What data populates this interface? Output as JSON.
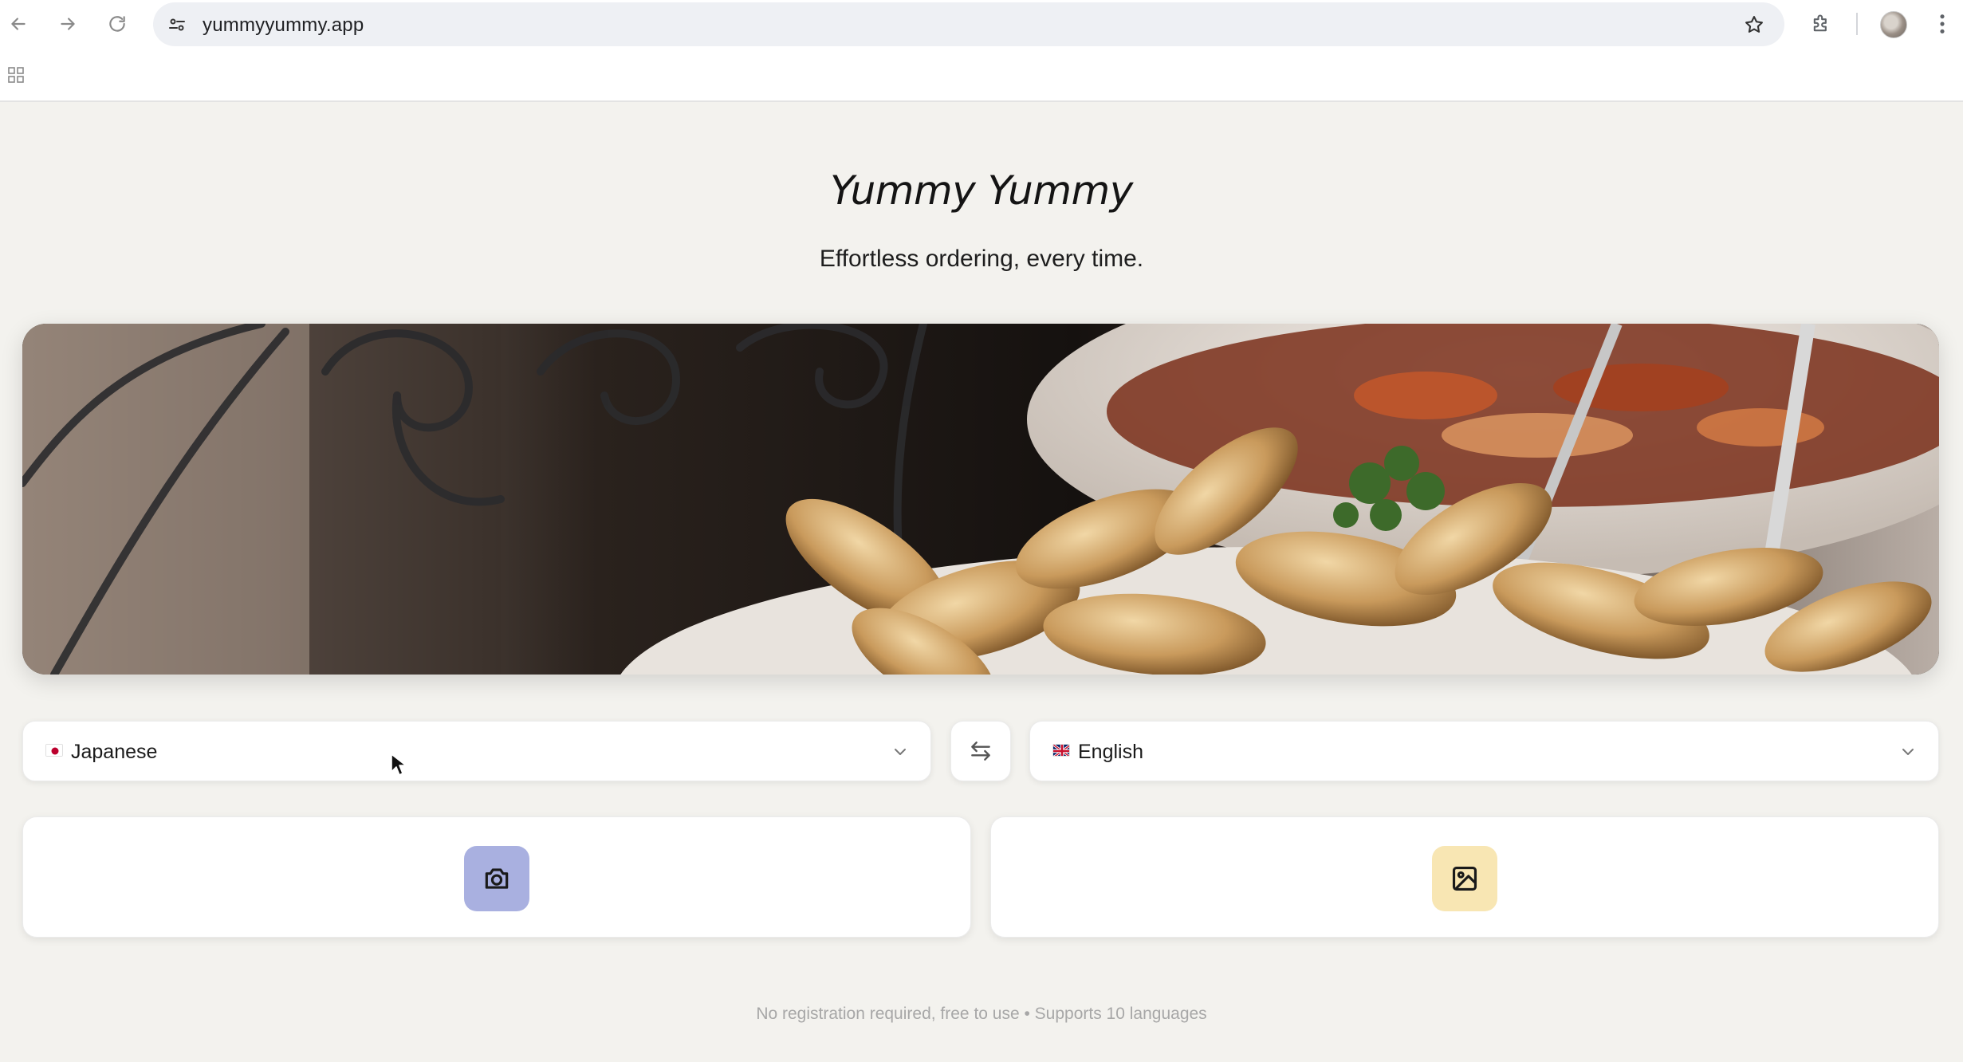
{
  "browser": {
    "url": "yummyyummy.app"
  },
  "page": {
    "title": "Yummy Yummy",
    "tagline": "Effortless ordering, every time."
  },
  "languages": {
    "source": {
      "label": "Japanese",
      "flag": "jp"
    },
    "target": {
      "label": "English",
      "flag": "gb"
    }
  },
  "actions": {
    "camera": {
      "icon": "camera-icon",
      "color": "#a9b0e0"
    },
    "gallery": {
      "icon": "image-icon",
      "color": "#f8e6b3"
    }
  },
  "footer": {
    "note": "No registration required, free to use • Supports 10 languages"
  }
}
